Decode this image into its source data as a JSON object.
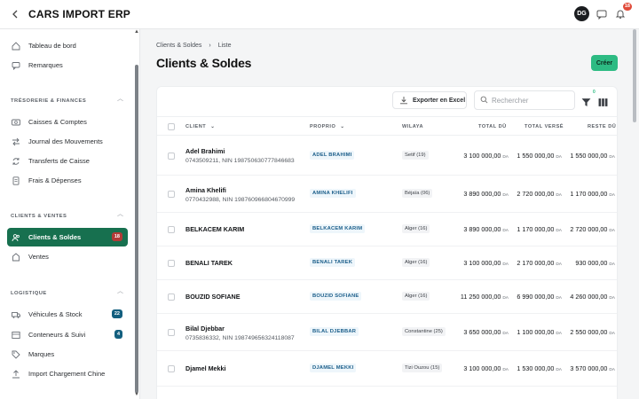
{
  "app": {
    "title": "CARS IMPORT ERP"
  },
  "user": {
    "initials": "DG",
    "notifications": "18"
  },
  "sidebar": {
    "top_items": [
      {
        "label": "Tableau de bord",
        "icon": "dashboard-icon"
      },
      {
        "label": "Remarques",
        "icon": "chat-icon"
      }
    ],
    "sections": [
      {
        "title": "TRÉSORERIE & FINANCES",
        "items": [
          {
            "label": "Caisses & Comptes",
            "icon": "cash-icon"
          },
          {
            "label": "Journal des Mouvements",
            "icon": "transfer-icon"
          },
          {
            "label": "Transferts de Caisse",
            "icon": "refresh-icon"
          },
          {
            "label": "Frais & Dépenses",
            "icon": "receipt-icon"
          }
        ]
      },
      {
        "title": "CLIENTS & VENTES",
        "items": [
          {
            "label": "Clients & Soldes",
            "icon": "users-icon",
            "badge": "18",
            "active": true
          },
          {
            "label": "Ventes",
            "icon": "cart-icon"
          }
        ]
      },
      {
        "title": "LOGISTIQUE",
        "items": [
          {
            "label": "Véhicules & Stock",
            "icon": "truck-icon",
            "badge": "22"
          },
          {
            "label": "Conteneurs & Suivi",
            "icon": "container-icon",
            "badge": "4"
          },
          {
            "label": "Marques",
            "icon": "tag-icon"
          },
          {
            "label": "Import Chargement Chine",
            "icon": "upload-icon"
          }
        ]
      }
    ]
  },
  "breadcrumb": [
    "Clients & Soldes",
    "Liste"
  ],
  "page_title": "Clients & Soldes",
  "create_label": "Créer",
  "toolbar": {
    "export_label": "Exporter en Excel",
    "search_placeholder": "Rechercher",
    "filter_count": "0"
  },
  "table": {
    "headers": {
      "client": "CLIENT",
      "proprio": "PROPRIO",
      "wilaya": "WILAYA",
      "total_du": "TOTAL DÛ",
      "total_verse": "TOTAL VERSÉ",
      "reste_du": "RESTE DÛ"
    },
    "currency": "DA",
    "rows": [
      {
        "name": "Adel Brahimi",
        "sub": "0743509211, NIN 198750630777846683",
        "proprio": "ADEL BRAHIMI",
        "wilaya": "Setif (19)",
        "total_du": "3 100 000,00",
        "total_verse": "1 550 000,00",
        "reste_du": "1 550 000,00"
      },
      {
        "name": "Amina Khelifi",
        "sub": "0770432988, NIN 198760966804670999",
        "proprio": "AMINA KHELIFI",
        "wilaya": "Béjaïa (06)",
        "total_du": "3 890 000,00",
        "total_verse": "2 720 000,00",
        "reste_du": "1 170 000,00"
      },
      {
        "name": "BELKACEM KARIM",
        "sub": "",
        "proprio": "BELKACEM KARIM",
        "wilaya": "Alger (16)",
        "total_du": "3 890 000,00",
        "total_verse": "1 170 000,00",
        "reste_du": "2 720 000,00"
      },
      {
        "name": "BENALI TAREK",
        "sub": "",
        "proprio": "BENALI TAREK",
        "wilaya": "Alger (16)",
        "total_du": "3 100 000,00",
        "total_verse": "2 170 000,00",
        "reste_du": "930 000,00"
      },
      {
        "name": "BOUZID SOFIANE",
        "sub": "",
        "proprio": "BOUZID SOFIANE",
        "wilaya": "Alger (16)",
        "total_du": "11 250 000,00",
        "total_verse": "6 990 000,00",
        "reste_du": "4 260 000,00"
      },
      {
        "name": "Bilal Djebbar",
        "sub": "0735836332, NIN 198749656324118087",
        "proprio": "BILAL DJEBBAR",
        "wilaya": "Constantine (25)",
        "total_du": "3 650 000,00",
        "total_verse": "1 100 000,00",
        "reste_du": "2 550 000,00"
      },
      {
        "name": "Djamel Mekki",
        "sub": "",
        "proprio": "DJAMEL MEKKI",
        "wilaya": "Tizi Ouzou (15)",
        "total_du": "3 100 000,00",
        "total_verse": "1 530 000,00",
        "reste_du": "3 570 000,00"
      }
    ]
  }
}
